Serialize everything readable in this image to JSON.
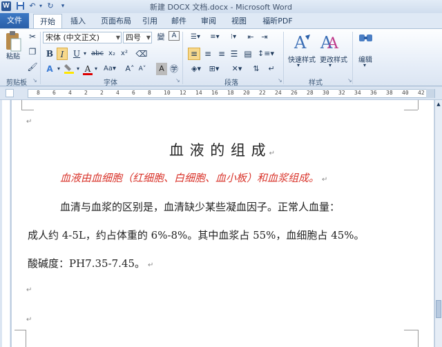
{
  "window": {
    "title": "新建 DOCX 文档.docx - Microsoft Word",
    "app_icon": "W"
  },
  "quick_access": [
    "save-icon",
    "undo-icon",
    "redo-icon",
    "customize-icon"
  ],
  "tabs": [
    {
      "label": "文件"
    },
    {
      "label": "开始"
    },
    {
      "label": "插入"
    },
    {
      "label": "页面布局"
    },
    {
      "label": "引用"
    },
    {
      "label": "邮件"
    },
    {
      "label": "审阅"
    },
    {
      "label": "视图"
    },
    {
      "label": "福昕PDF"
    }
  ],
  "ribbon": {
    "clipboard": {
      "label": "剪贴板",
      "paste": "粘贴"
    },
    "font": {
      "label": "字体",
      "font_name": "宋体 (中文正文)",
      "font_size": "四号",
      "wen": "變",
      "a_box": "A"
    },
    "paragraph": {
      "label": "段落"
    },
    "styles": {
      "label": "样式",
      "quick_styles": "快速样式",
      "change_styles": "更改样式"
    },
    "editing": {
      "label": "编辑"
    }
  },
  "ruler_numbers": [
    "8",
    "6",
    "4",
    "2",
    "2",
    "4",
    "6",
    "8",
    "10",
    "12",
    "14",
    "16",
    "18",
    "20",
    "22",
    "24",
    "26",
    "28",
    "30",
    "32",
    "34",
    "36",
    "38",
    "40",
    "42"
  ],
  "document": {
    "title": "血 液 的 组 成",
    "subtitle": "血液由血细胞（红细胞、白细胞、血小板）和血浆组成。",
    "line1": "血清与血浆的区别是，血清缺少某些凝血因子。正常人血量：",
    "line2": "成人约 4-5L，约占体重的 6%-8%。其中血浆占 55%，血细胞占 45%。",
    "line3": "酸碱度：PH7.35-7.45。",
    "para_mark": "↵"
  },
  "colors": {
    "accent": "#2b5797",
    "red_text": "#d9342b"
  }
}
